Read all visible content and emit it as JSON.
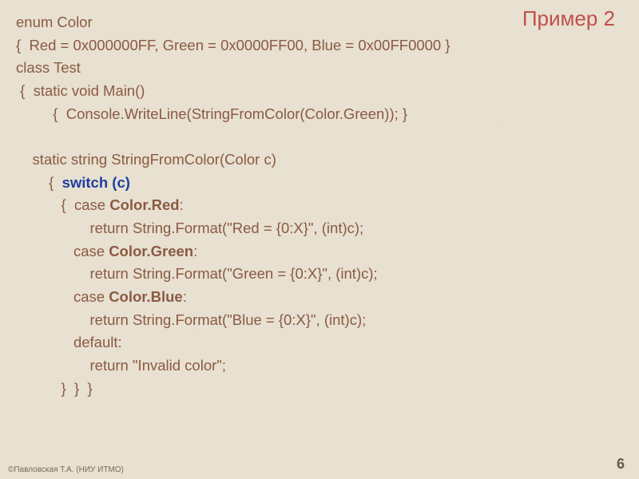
{
  "title": "Пример 2",
  "code": {
    "l1": "enum Color",
    "l2": "{  Red = 0x000000FF, Green = 0x0000FF00, Blue = 0x00FF0000 }",
    "l3": "class Test",
    "l4": " {  static void Main()",
    "l5": "         {  Console.WriteLine(StringFromColor(Color.Green)); }",
    "l6": "    static string StringFromColor(Color c)",
    "l7_a": "        {  ",
    "l7_switch": "switch (c)",
    "l8_a": "           {  case ",
    "l8_red": "Color.Red",
    "l8_b": ":",
    "l9": "                  return String.Format(\"Red = {0:X}\", (int)c);",
    "l10_a": "              case ",
    "l10_green": "Color.Green",
    "l10_b": ":",
    "l11": "                  return String.Format(\"Green = {0:X}\", (int)c);",
    "l12_a": "              case ",
    "l12_blue": "Color.Blue",
    "l12_b": ":",
    "l13": "                  return String.Format(\"Blue = {0:X}\", (int)c);",
    "l14": "              default:",
    "l15": "                  return \"Invalid color\";",
    "l16": "           }  }  }"
  },
  "footer": "©Павловская Т.А. (НИУ ИТМО)",
  "page": "6"
}
